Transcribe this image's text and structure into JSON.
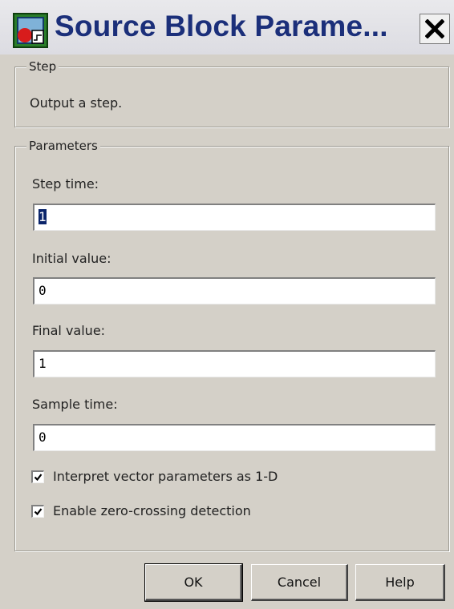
{
  "window": {
    "title": "Source Block Parame...",
    "close_label": "X"
  },
  "step_group": {
    "legend": "Step",
    "description": "Output a step."
  },
  "parameters": {
    "legend": "Parameters",
    "step_time": {
      "label": "Step time:",
      "value": "1"
    },
    "initial_value": {
      "label": "Initial value:",
      "value": "0"
    },
    "final_value": {
      "label": "Final value:",
      "value": "1"
    },
    "sample_time": {
      "label": "Sample time:",
      "value": "0"
    },
    "interpret_vector": {
      "label": "Interpret vector parameters as 1-D",
      "checked": true
    },
    "zero_crossing": {
      "label": "Enable zero-crossing detection",
      "checked": true
    }
  },
  "buttons": {
    "ok": "OK",
    "cancel": "Cancel",
    "help": "Help"
  },
  "icons": {
    "app": "simulink-block-icon",
    "close": "close-icon",
    "check": "check-icon"
  }
}
